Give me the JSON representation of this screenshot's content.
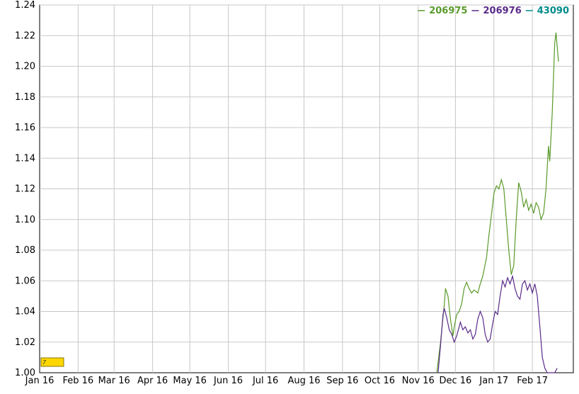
{
  "chart_data": {
    "type": "line",
    "ylim": [
      1.0,
      1.24
    ],
    "y_ticks": [
      "1.00",
      "1.02",
      "1.04",
      "1.06",
      "1.08",
      "1.10",
      "1.12",
      "1.14",
      "1.16",
      "1.18",
      "1.20",
      "1.22",
      "1.24"
    ],
    "x_range": [
      "2016-01-01",
      "2017-03-06"
    ],
    "x_ticks": [
      {
        "label": "Jan 16",
        "date": "2016-01-01"
      },
      {
        "label": "Feb 16",
        "date": "2016-02-01"
      },
      {
        "label": "Mar 16",
        "date": "2016-03-01"
      },
      {
        "label": "Apr 16",
        "date": "2016-04-01"
      },
      {
        "label": "May 16",
        "date": "2016-05-01"
      },
      {
        "label": "Jun 16",
        "date": "2016-06-01"
      },
      {
        "label": "Jul 16",
        "date": "2016-07-01"
      },
      {
        "label": "Aug 16",
        "date": "2016-08-01"
      },
      {
        "label": "Sep 16",
        "date": "2016-09-01"
      },
      {
        "label": "Oct 16",
        "date": "2016-10-01"
      },
      {
        "label": "Nov 16",
        "date": "2016-11-01"
      },
      {
        "label": "Dec 16",
        "date": "2016-12-01"
      },
      {
        "label": "Jan 17",
        "date": "2017-01-01"
      },
      {
        "label": "Feb 17",
        "date": "2017-02-01"
      }
    ],
    "grid": true,
    "legend_position": "top-right",
    "series": [
      {
        "name": "206975",
        "color": "#5a9a2a",
        "points": [
          [
            "2016-11-16",
            1.0
          ],
          [
            "2016-11-19",
            1.02
          ],
          [
            "2016-11-22",
            1.044
          ],
          [
            "2016-11-23",
            1.055
          ],
          [
            "2016-11-25",
            1.05
          ],
          [
            "2016-11-27",
            1.035
          ],
          [
            "2016-11-29",
            1.024
          ],
          [
            "2016-11-30",
            1.03
          ],
          [
            "2016-12-02",
            1.038
          ],
          [
            "2016-12-04",
            1.04
          ],
          [
            "2016-12-06",
            1.045
          ],
          [
            "2016-12-08",
            1.055
          ],
          [
            "2016-12-10",
            1.059
          ],
          [
            "2016-12-12",
            1.055
          ],
          [
            "2016-12-14",
            1.052
          ],
          [
            "2016-12-16",
            1.054
          ],
          [
            "2016-12-19",
            1.052
          ],
          [
            "2016-12-21",
            1.058
          ],
          [
            "2016-12-23",
            1.063
          ],
          [
            "2016-12-26",
            1.075
          ],
          [
            "2016-12-28",
            1.09
          ],
          [
            "2016-12-30",
            1.103
          ],
          [
            "2017-01-01",
            1.117
          ],
          [
            "2017-01-03",
            1.122
          ],
          [
            "2017-01-05",
            1.12
          ],
          [
            "2017-01-07",
            1.126
          ],
          [
            "2017-01-09",
            1.12
          ],
          [
            "2017-01-11",
            1.1
          ],
          [
            "2017-01-13",
            1.08
          ],
          [
            "2017-01-15",
            1.064
          ],
          [
            "2017-01-17",
            1.07
          ],
          [
            "2017-01-19",
            1.1
          ],
          [
            "2017-01-21",
            1.124
          ],
          [
            "2017-01-23",
            1.118
          ],
          [
            "2017-01-25",
            1.108
          ],
          [
            "2017-01-27",
            1.113
          ],
          [
            "2017-01-29",
            1.106
          ],
          [
            "2017-01-31",
            1.11
          ],
          [
            "2017-02-02",
            1.104
          ],
          [
            "2017-02-04",
            1.111
          ],
          [
            "2017-02-06",
            1.108
          ],
          [
            "2017-02-08",
            1.1
          ],
          [
            "2017-02-10",
            1.104
          ],
          [
            "2017-02-12",
            1.12
          ],
          [
            "2017-02-14",
            1.148
          ],
          [
            "2017-02-15",
            1.138
          ],
          [
            "2017-02-17",
            1.17
          ],
          [
            "2017-02-19",
            1.215
          ],
          [
            "2017-02-20",
            1.222
          ],
          [
            "2017-02-22",
            1.203
          ]
        ]
      },
      {
        "name": "206976",
        "color": "#5a2a8a",
        "points": [
          [
            "2016-11-17",
            1.0
          ],
          [
            "2016-11-19",
            1.018
          ],
          [
            "2016-11-21",
            1.038
          ],
          [
            "2016-11-22",
            1.042
          ],
          [
            "2016-11-24",
            1.036
          ],
          [
            "2016-11-26",
            1.028
          ],
          [
            "2016-11-28",
            1.025
          ],
          [
            "2016-11-30",
            1.02
          ],
          [
            "2016-12-02",
            1.024
          ],
          [
            "2016-12-04",
            1.03
          ],
          [
            "2016-12-05",
            1.033
          ],
          [
            "2016-12-07",
            1.028
          ],
          [
            "2016-12-09",
            1.03
          ],
          [
            "2016-12-11",
            1.026
          ],
          [
            "2016-12-13",
            1.028
          ],
          [
            "2016-12-15",
            1.022
          ],
          [
            "2016-12-17",
            1.025
          ],
          [
            "2016-12-19",
            1.035
          ],
          [
            "2016-12-21",
            1.04
          ],
          [
            "2016-12-23",
            1.036
          ],
          [
            "2016-12-25",
            1.025
          ],
          [
            "2016-12-27",
            1.02
          ],
          [
            "2016-12-29",
            1.022
          ],
          [
            "2016-12-31",
            1.032
          ],
          [
            "2017-01-02",
            1.04
          ],
          [
            "2017-01-04",
            1.038
          ],
          [
            "2017-01-06",
            1.05
          ],
          [
            "2017-01-08",
            1.06
          ],
          [
            "2017-01-10",
            1.056
          ],
          [
            "2017-01-12",
            1.062
          ],
          [
            "2017-01-14",
            1.058
          ],
          [
            "2017-01-16",
            1.063
          ],
          [
            "2017-01-18",
            1.055
          ],
          [
            "2017-01-20",
            1.05
          ],
          [
            "2017-01-22",
            1.048
          ],
          [
            "2017-01-24",
            1.058
          ],
          [
            "2017-01-26",
            1.06
          ],
          [
            "2017-01-28",
            1.054
          ],
          [
            "2017-01-30",
            1.058
          ],
          [
            "2017-02-01",
            1.052
          ],
          [
            "2017-02-03",
            1.058
          ],
          [
            "2017-02-05",
            1.05
          ],
          [
            "2017-02-07",
            1.03
          ],
          [
            "2017-02-09",
            1.01
          ],
          [
            "2017-02-11",
            1.003
          ],
          [
            "2017-02-13",
            1.0
          ],
          [
            "2017-02-16",
            1.0
          ],
          [
            "2017-02-19",
            1.0
          ],
          [
            "2017-02-21",
            1.003
          ]
        ]
      },
      {
        "name": "43090",
        "color": "#008b8b",
        "points": []
      }
    ],
    "marker_label": "7",
    "marker_color": "#ffd700"
  }
}
